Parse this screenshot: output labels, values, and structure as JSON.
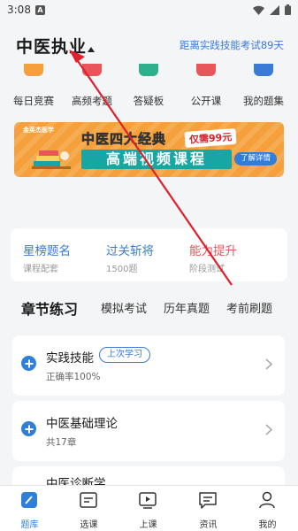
{
  "status_bar": {
    "time": "3:08",
    "notification_glyph": "A"
  },
  "header": {
    "title": "中医执业",
    "countdown": "距离实践技能考试89天"
  },
  "quick_entries": [
    {
      "label": "每日竞赛",
      "icon": "daily-contest-icon",
      "color": "#f5a03a"
    },
    {
      "label": "高频考题",
      "icon": "frequent-questions-icon",
      "color": "#e8555a"
    },
    {
      "label": "答疑板",
      "icon": "qa-board-icon",
      "color": "#2fb08c"
    },
    {
      "label": "公开课",
      "icon": "open-class-icon",
      "color": "#e8555a"
    },
    {
      "label": "我的题集",
      "icon": "my-questions-icon",
      "color": "#3a7bd5"
    }
  ],
  "banner": {
    "logo_text": "金英杰医学",
    "title_line1": "中医四大经典",
    "price": "仅需99元",
    "title_line2": "高端视频课程",
    "button": "了解详情"
  },
  "feature_cards": [
    {
      "title": "星榜题名",
      "subtitle": "课程配套",
      "color": "#3a7bd5"
    },
    {
      "title": "过关斩将",
      "subtitle": "1500题",
      "color": "#3a7bd5"
    },
    {
      "title": "能力提升",
      "subtitle": "阶段测试",
      "color": "#e8555a"
    }
  ],
  "tabs": [
    "章节练习",
    "模拟考试",
    "历年真题",
    "考前刷题"
  ],
  "chapters": [
    {
      "title": "实践技能",
      "badge": "上次学习",
      "subtitle": "正确率100%"
    },
    {
      "title": "中医基础理论",
      "subtitle": "共17章"
    },
    {
      "title": "中医诊断学"
    }
  ],
  "bottom_nav": [
    {
      "label": "题库",
      "icon": "question-bank-icon",
      "active": true
    },
    {
      "label": "选课",
      "icon": "course-select-icon",
      "active": false
    },
    {
      "label": "上课",
      "icon": "video-class-icon",
      "active": false
    },
    {
      "label": "资讯",
      "icon": "news-icon",
      "active": false
    },
    {
      "label": "我的",
      "icon": "profile-icon",
      "active": false
    }
  ],
  "colors": {
    "accent": "#2f7fd8",
    "annotation_arrow": "#e0202a"
  }
}
